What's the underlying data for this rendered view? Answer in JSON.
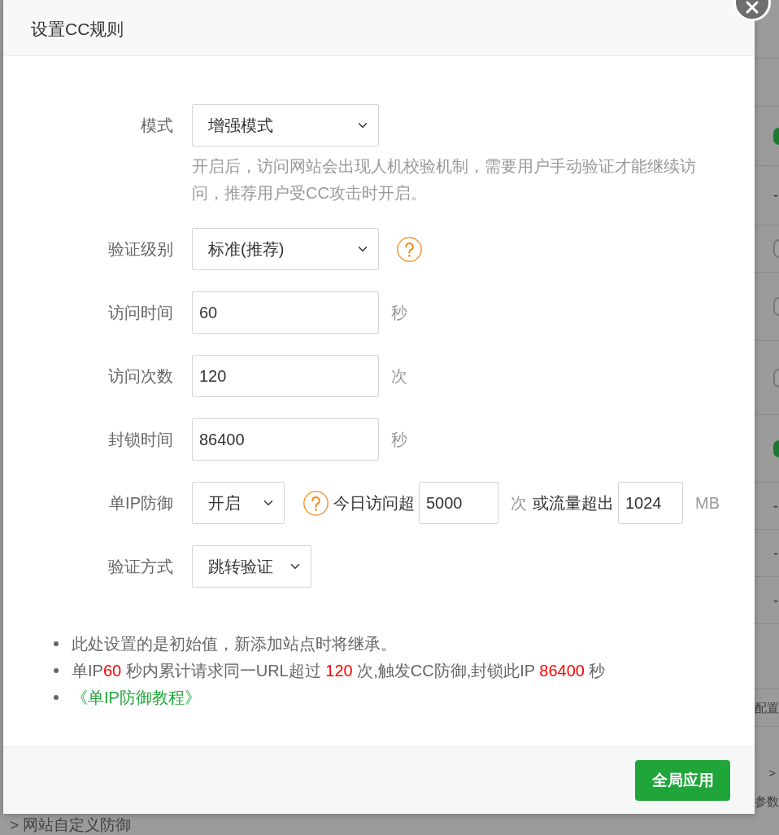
{
  "background_page": {
    "status_column": [
      {
        "kind": "switch",
        "on": true
      },
      {
        "kind": "dash",
        "text": "-"
      },
      {
        "kind": "switch",
        "on": false
      },
      {
        "kind": "switch",
        "on": false
      },
      {
        "kind": "switch",
        "on": false
      },
      {
        "kind": "switch",
        "on": true
      },
      {
        "kind": "dash",
        "text": "-"
      },
      {
        "kind": "dash",
        "text": "-"
      },
      {
        "kind": "dash",
        "text": "-"
      }
    ],
    "config_link": "配置",
    "path_separator": ">",
    "params_label": "参数",
    "breadcrumb": "> 网站自定义防御"
  },
  "dialog": {
    "title": "设置CC规则"
  },
  "form": {
    "rows": [
      {
        "kind": "select",
        "label": "模式",
        "value": "增强模式",
        "help": "开启后，访问网站会出现人机校验机制，需要用户手动验证才能继续访问，推荐用户受CC攻击时开启。"
      },
      {
        "kind": "select",
        "label": "验证级别",
        "value": "标准(推荐)",
        "help_icon": true
      },
      {
        "kind": "input",
        "label": "访问时间",
        "value": "60",
        "unit": "秒"
      },
      {
        "kind": "input",
        "label": "访问次数",
        "value": "120",
        "unit": "次"
      },
      {
        "kind": "input",
        "label": "封锁时间",
        "value": "86400",
        "unit": "秒"
      },
      {
        "kind": "ip_limit",
        "label": "单IP防御",
        "value": "开启",
        "help_icon": true,
        "daily_label": "今日访问超",
        "daily_value": "5000",
        "daily_unit": "次",
        "traffic_label": "或流量超出",
        "traffic_value": "1024",
        "traffic_unit": "MB"
      },
      {
        "kind": "select",
        "label": "验证方式",
        "value": "跳转验证"
      }
    ]
  },
  "notes": [
    {
      "kind": "text",
      "parts": [
        {
          "text": "此处设置的是初始值，新添加站点时将继承。",
          "highlight": false
        }
      ]
    },
    {
      "kind": "text",
      "parts": [
        {
          "text": "单IP",
          "highlight": false
        },
        {
          "text": "60",
          "highlight": true
        },
        {
          "text": " 秒内累计请求同一URL超过 ",
          "highlight": false
        },
        {
          "text": "120",
          "highlight": true
        },
        {
          "text": " 次,触发CC防御,封锁此IP ",
          "highlight": false
        },
        {
          "text": "86400",
          "highlight": true
        },
        {
          "text": " 秒",
          "highlight": false
        }
      ]
    },
    {
      "kind": "link",
      "text": "《单IP防御教程》"
    }
  ],
  "footer": {
    "button": "全局应用"
  }
}
